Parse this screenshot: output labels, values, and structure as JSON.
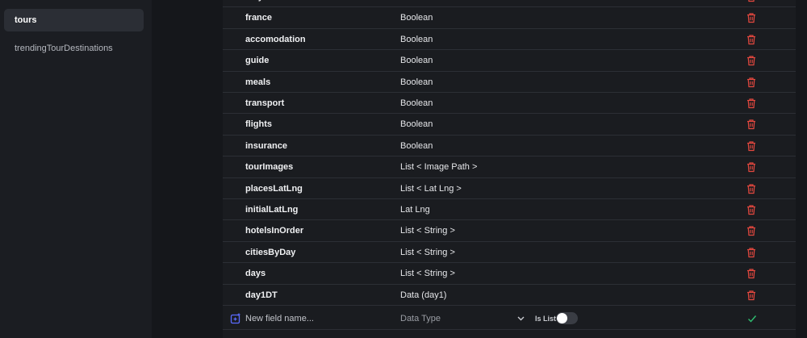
{
  "sidebar": {
    "items": [
      {
        "label": "tours",
        "active": true
      },
      {
        "label": "trendingTourDestinations",
        "active": false
      }
    ]
  },
  "fields": [
    {
      "name": "italy",
      "type": ""
    },
    {
      "name": "france",
      "type": "Boolean"
    },
    {
      "name": "accomodation",
      "type": "Boolean"
    },
    {
      "name": "guide",
      "type": "Boolean"
    },
    {
      "name": "meals",
      "type": "Boolean"
    },
    {
      "name": "transport",
      "type": "Boolean"
    },
    {
      "name": "flights",
      "type": "Boolean"
    },
    {
      "name": "insurance",
      "type": "Boolean"
    },
    {
      "name": "tourImages",
      "type": "List < Image Path >"
    },
    {
      "name": "placesLatLng",
      "type": "List < Lat Lng >"
    },
    {
      "name": "initialLatLng",
      "type": "Lat Lng"
    },
    {
      "name": "hotelsInOrder",
      "type": "List < String >"
    },
    {
      "name": "citiesByDay",
      "type": "List < String >"
    },
    {
      "name": "days",
      "type": "List < String >"
    },
    {
      "name": "day1DT",
      "type": "Data (day1)"
    }
  ],
  "new_field": {
    "name_placeholder": "New field name...",
    "type_placeholder": "Data Type",
    "is_list_label": "Is List",
    "is_list_on": false
  },
  "icons": {
    "delete": "trash-icon",
    "add": "add-field-icon",
    "confirm": "checkmark-icon",
    "dropdown": "chevron-down-icon"
  },
  "colors": {
    "delete": "#e5483f",
    "accent_add": "#5b6bff",
    "confirm": "#2fbf71"
  }
}
